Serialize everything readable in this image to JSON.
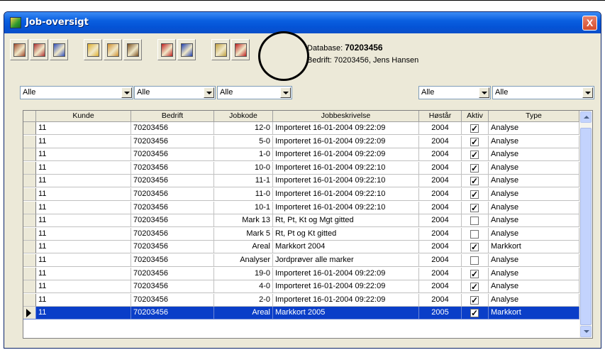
{
  "window": {
    "title": "Job-oversigt",
    "close_label": "X"
  },
  "toolbar": {
    "buttons": [
      {
        "name": "exit-icon",
        "color": "#a0482a"
      },
      {
        "name": "check-red-icon",
        "color": "#b03030"
      },
      {
        "name": "check-blue-icon",
        "color": "#3050c0"
      },
      {
        "name": "chart-up-icon",
        "color": "#e0b030"
      },
      {
        "name": "chart-down-icon",
        "color": "#d09030"
      },
      {
        "name": "person-icon",
        "color": "#7a5020"
      },
      {
        "name": "export-icon",
        "color": "#c02020"
      },
      {
        "name": "import-icon",
        "color": "#2040b0"
      },
      {
        "name": "folder-in-icon",
        "color": "#c0a040"
      },
      {
        "name": "folder-out-icon",
        "color": "#c02020"
      }
    ]
  },
  "db_info": {
    "database_label": "Database:",
    "database_value": "70203456",
    "company_label": "Bedrift:",
    "company_value": "70203456, Jens Hansen"
  },
  "filters": {
    "f1": "Alle",
    "f2": "Alle",
    "f3": "Alle",
    "f4": "Alle",
    "f5": "Alle"
  },
  "table": {
    "headers": [
      "Kunde",
      "Bedrift",
      "Jobkode",
      "Jobbeskrivelse",
      "Høstår",
      "Aktiv",
      "Type"
    ],
    "rows": [
      {
        "kunde": "11",
        "bedrift": "70203456",
        "jobkode": "12-0",
        "beskrivelse": "Importeret 16-01-2004 09:22:09",
        "aar": "2004",
        "aktiv": true,
        "type": "Analyse"
      },
      {
        "kunde": "11",
        "bedrift": "70203456",
        "jobkode": "5-0",
        "beskrivelse": "Importeret 16-01-2004 09:22:09",
        "aar": "2004",
        "aktiv": true,
        "type": "Analyse"
      },
      {
        "kunde": "11",
        "bedrift": "70203456",
        "jobkode": "1-0",
        "beskrivelse": "Importeret 16-01-2004 09:22:09",
        "aar": "2004",
        "aktiv": true,
        "type": "Analyse"
      },
      {
        "kunde": "11",
        "bedrift": "70203456",
        "jobkode": "10-0",
        "beskrivelse": "Importeret 16-01-2004 09:22:10",
        "aar": "2004",
        "aktiv": true,
        "type": "Analyse"
      },
      {
        "kunde": "11",
        "bedrift": "70203456",
        "jobkode": "11-1",
        "beskrivelse": "Importeret 16-01-2004 09:22:10",
        "aar": "2004",
        "aktiv": true,
        "type": "Analyse"
      },
      {
        "kunde": "11",
        "bedrift": "70203456",
        "jobkode": "11-0",
        "beskrivelse": "Importeret 16-01-2004 09:22:10",
        "aar": "2004",
        "aktiv": true,
        "type": "Analyse"
      },
      {
        "kunde": "11",
        "bedrift": "70203456",
        "jobkode": "10-1",
        "beskrivelse": "Importeret 16-01-2004 09:22:10",
        "aar": "2004",
        "aktiv": true,
        "type": "Analyse"
      },
      {
        "kunde": "11",
        "bedrift": "70203456",
        "jobkode": "Mark 13",
        "beskrivelse": "Rt, Pt, Kt og Mgt gitted",
        "aar": "2004",
        "aktiv": false,
        "type": "Analyse"
      },
      {
        "kunde": "11",
        "bedrift": "70203456",
        "jobkode": "Mark 5",
        "beskrivelse": "Rt, Pt og Kt gitted",
        "aar": "2004",
        "aktiv": false,
        "type": "Analyse"
      },
      {
        "kunde": "11",
        "bedrift": "70203456",
        "jobkode": "Areal",
        "beskrivelse": "Markkort 2004",
        "aar": "2004",
        "aktiv": true,
        "type": "Markkort"
      },
      {
        "kunde": "11",
        "bedrift": "70203456",
        "jobkode": "Analyser",
        "beskrivelse": "Jordprøver alle marker",
        "aar": "2004",
        "aktiv": false,
        "type": "Analyse"
      },
      {
        "kunde": "11",
        "bedrift": "70203456",
        "jobkode": "19-0",
        "beskrivelse": "Importeret 16-01-2004 09:22:09",
        "aar": "2004",
        "aktiv": true,
        "type": "Analyse"
      },
      {
        "kunde": "11",
        "bedrift": "70203456",
        "jobkode": "4-0",
        "beskrivelse": "Importeret 16-01-2004 09:22:09",
        "aar": "2004",
        "aktiv": true,
        "type": "Analyse"
      },
      {
        "kunde": "11",
        "bedrift": "70203456",
        "jobkode": "2-0",
        "beskrivelse": "Importeret 16-01-2004 09:22:09",
        "aar": "2004",
        "aktiv": true,
        "type": "Analyse"
      },
      {
        "kunde": "11",
        "bedrift": "70203456",
        "jobkode": "Areal",
        "beskrivelse": "Markkort 2005",
        "aar": "2005",
        "aktiv": true,
        "type": "Markkort",
        "selected": true
      }
    ]
  }
}
